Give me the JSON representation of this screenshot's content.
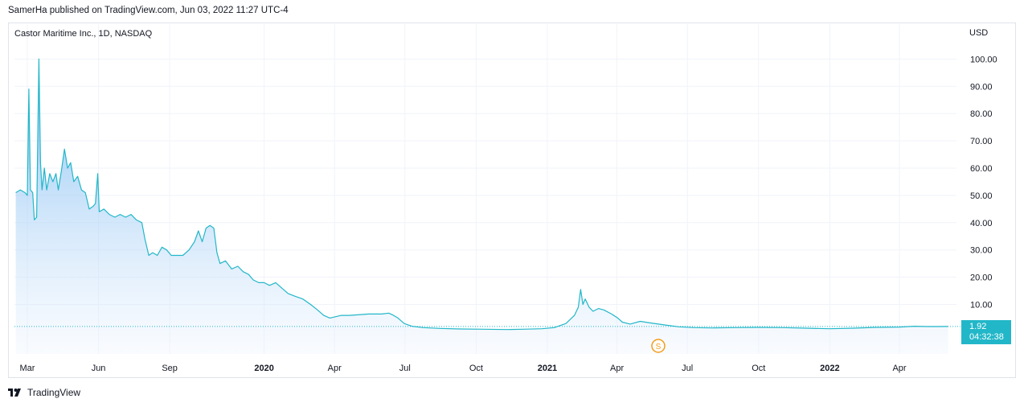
{
  "header": {
    "published": "SamerHa published on TradingView.com, Jun 03, 2022 11:27 UTC-4"
  },
  "footer": {
    "brand": "TradingView",
    "logo_icon": "tradingview-logo-icon"
  },
  "price_badge": {
    "price": "1.92",
    "countdown": "04:32:38"
  },
  "marker": {
    "label": "S",
    "icon": "split-marker-icon",
    "color": "#f59c1a"
  },
  "colors": {
    "line": "#22b7c8",
    "area_top": "#5aa9ee",
    "area_bottom": "#eef4fe",
    "grid": "#f0f3fa"
  },
  "chart_data": {
    "type": "area",
    "title": "Castor Maritime Inc., 1D, NASDAQ",
    "currency": "USD",
    "ylim": [
      -10,
      110
    ],
    "yticks": [
      "100.00",
      "90.00",
      "80.00",
      "70.00",
      "60.00",
      "50.00",
      "40.00",
      "30.00",
      "20.00",
      "10.00"
    ],
    "ytick_values": [
      100,
      90,
      80,
      70,
      60,
      50,
      40,
      30,
      20,
      10
    ],
    "xticks": [
      {
        "label": "Mar",
        "date": "2019-03-01",
        "bold": false
      },
      {
        "label": "Jun",
        "date": "2019-06-01",
        "bold": false
      },
      {
        "label": "Sep",
        "date": "2019-09-01",
        "bold": false
      },
      {
        "label": "2020",
        "date": "2020-01-01",
        "bold": true
      },
      {
        "label": "Apr",
        "date": "2020-04-01",
        "bold": false
      },
      {
        "label": "Jul",
        "date": "2020-07-01",
        "bold": false
      },
      {
        "label": "Oct",
        "date": "2020-10-01",
        "bold": false
      },
      {
        "label": "2021",
        "date": "2021-01-01",
        "bold": true
      },
      {
        "label": "Apr",
        "date": "2021-04-01",
        "bold": false
      },
      {
        "label": "Jul",
        "date": "2021-07-01",
        "bold": false
      },
      {
        "label": "Oct",
        "date": "2021-10-01",
        "bold": false
      },
      {
        "label": "2022",
        "date": "2022-01-01",
        "bold": true
      },
      {
        "label": "Apr",
        "date": "2022-04-01",
        "bold": false
      }
    ],
    "last_price": 1.92,
    "series": [
      {
        "points": [
          [
            "2019-02-14",
            51
          ],
          [
            "2019-02-20",
            52
          ],
          [
            "2019-02-26",
            51
          ],
          [
            "2019-03-01",
            50
          ],
          [
            "2019-03-03",
            89
          ],
          [
            "2019-03-05",
            52
          ],
          [
            "2019-03-08",
            51
          ],
          [
            "2019-03-10",
            41
          ],
          [
            "2019-03-13",
            42
          ],
          [
            "2019-03-16",
            100
          ],
          [
            "2019-03-18",
            62
          ],
          [
            "2019-03-20",
            52
          ],
          [
            "2019-03-23",
            60
          ],
          [
            "2019-03-26",
            52
          ],
          [
            "2019-03-30",
            58
          ],
          [
            "2019-04-03",
            55
          ],
          [
            "2019-04-07",
            58
          ],
          [
            "2019-04-10",
            52
          ],
          [
            "2019-04-14",
            59
          ],
          [
            "2019-04-18",
            67
          ],
          [
            "2019-04-22",
            60
          ],
          [
            "2019-04-26",
            62
          ],
          [
            "2019-04-30",
            55
          ],
          [
            "2019-05-05",
            57
          ],
          [
            "2019-05-10",
            52
          ],
          [
            "2019-05-15",
            51
          ],
          [
            "2019-05-20",
            45
          ],
          [
            "2019-05-25",
            46
          ],
          [
            "2019-05-28",
            47
          ],
          [
            "2019-05-31",
            58
          ],
          [
            "2019-06-02",
            44
          ],
          [
            "2019-06-08",
            45
          ],
          [
            "2019-06-15",
            43
          ],
          [
            "2019-06-22",
            42
          ],
          [
            "2019-06-29",
            43
          ],
          [
            "2019-07-06",
            42
          ],
          [
            "2019-07-13",
            43
          ],
          [
            "2019-07-20",
            41
          ],
          [
            "2019-07-27",
            40
          ],
          [
            "2019-07-31",
            34
          ],
          [
            "2019-08-05",
            28
          ],
          [
            "2019-08-10",
            29
          ],
          [
            "2019-08-16",
            28
          ],
          [
            "2019-08-22",
            31
          ],
          [
            "2019-08-28",
            30
          ],
          [
            "2019-09-03",
            28
          ],
          [
            "2019-09-10",
            28
          ],
          [
            "2019-09-18",
            28
          ],
          [
            "2019-09-26",
            30
          ],
          [
            "2019-10-03",
            33
          ],
          [
            "2019-10-08",
            37
          ],
          [
            "2019-10-13",
            33
          ],
          [
            "2019-10-18",
            38
          ],
          [
            "2019-10-23",
            39
          ],
          [
            "2019-10-28",
            38
          ],
          [
            "2019-11-01",
            29
          ],
          [
            "2019-11-05",
            25
          ],
          [
            "2019-11-12",
            26
          ],
          [
            "2019-11-20",
            23
          ],
          [
            "2019-11-28",
            24
          ],
          [
            "2019-12-05",
            22
          ],
          [
            "2019-12-12",
            21
          ],
          [
            "2019-12-18",
            19
          ],
          [
            "2019-12-25",
            18
          ],
          [
            "2020-01-01",
            18
          ],
          [
            "2020-01-08",
            17
          ],
          [
            "2020-01-16",
            18
          ],
          [
            "2020-01-24",
            16
          ],
          [
            "2020-02-01",
            14
          ],
          [
            "2020-02-10",
            13
          ],
          [
            "2020-02-20",
            12
          ],
          [
            "2020-03-01",
            10
          ],
          [
            "2020-03-10",
            8
          ],
          [
            "2020-03-18",
            6
          ],
          [
            "2020-03-26",
            5
          ],
          [
            "2020-04-02",
            5.5
          ],
          [
            "2020-04-10",
            6
          ],
          [
            "2020-04-20",
            6
          ],
          [
            "2020-05-01",
            6.2
          ],
          [
            "2020-05-15",
            6.5
          ],
          [
            "2020-06-01",
            6.5
          ],
          [
            "2020-06-10",
            6.8
          ],
          [
            "2020-06-15",
            6.2
          ],
          [
            "2020-06-22",
            5
          ],
          [
            "2020-06-30",
            3
          ],
          [
            "2020-07-10",
            2
          ],
          [
            "2020-07-25",
            1.5
          ],
          [
            "2020-08-15",
            1.2
          ],
          [
            "2020-09-10",
            1.0
          ],
          [
            "2020-10-10",
            0.9
          ],
          [
            "2020-11-10",
            0.8
          ],
          [
            "2020-12-01",
            0.9
          ],
          [
            "2020-12-25",
            1.1
          ],
          [
            "2021-01-10",
            1.5
          ],
          [
            "2021-01-25",
            3
          ],
          [
            "2021-02-05",
            6
          ],
          [
            "2021-02-10",
            9
          ],
          [
            "2021-02-13",
            15.5
          ],
          [
            "2021-02-16",
            10
          ],
          [
            "2021-02-19",
            12
          ],
          [
            "2021-02-24",
            9
          ],
          [
            "2021-03-01",
            7.5
          ],
          [
            "2021-03-08",
            8.5
          ],
          [
            "2021-03-15",
            8
          ],
          [
            "2021-03-25",
            6.5
          ],
          [
            "2021-04-02",
            5
          ],
          [
            "2021-04-08",
            3.5
          ],
          [
            "2021-04-18",
            2.8
          ],
          [
            "2021-05-01",
            3.8
          ],
          [
            "2021-05-15",
            3.2
          ],
          [
            "2021-06-01",
            2.5
          ],
          [
            "2021-06-20",
            1.8
          ],
          [
            "2021-07-10",
            1.5
          ],
          [
            "2021-08-01",
            1.4
          ],
          [
            "2021-09-01",
            1.5
          ],
          [
            "2021-10-01",
            1.6
          ],
          [
            "2021-11-01",
            1.5
          ],
          [
            "2021-12-01",
            1.3
          ],
          [
            "2022-01-01",
            1.1
          ],
          [
            "2022-02-01",
            1.3
          ],
          [
            "2022-03-01",
            1.6
          ],
          [
            "2022-04-01",
            1.7
          ],
          [
            "2022-04-20",
            2.0
          ],
          [
            "2022-05-10",
            1.9
          ],
          [
            "2022-06-03",
            1.92
          ]
        ]
      }
    ]
  }
}
